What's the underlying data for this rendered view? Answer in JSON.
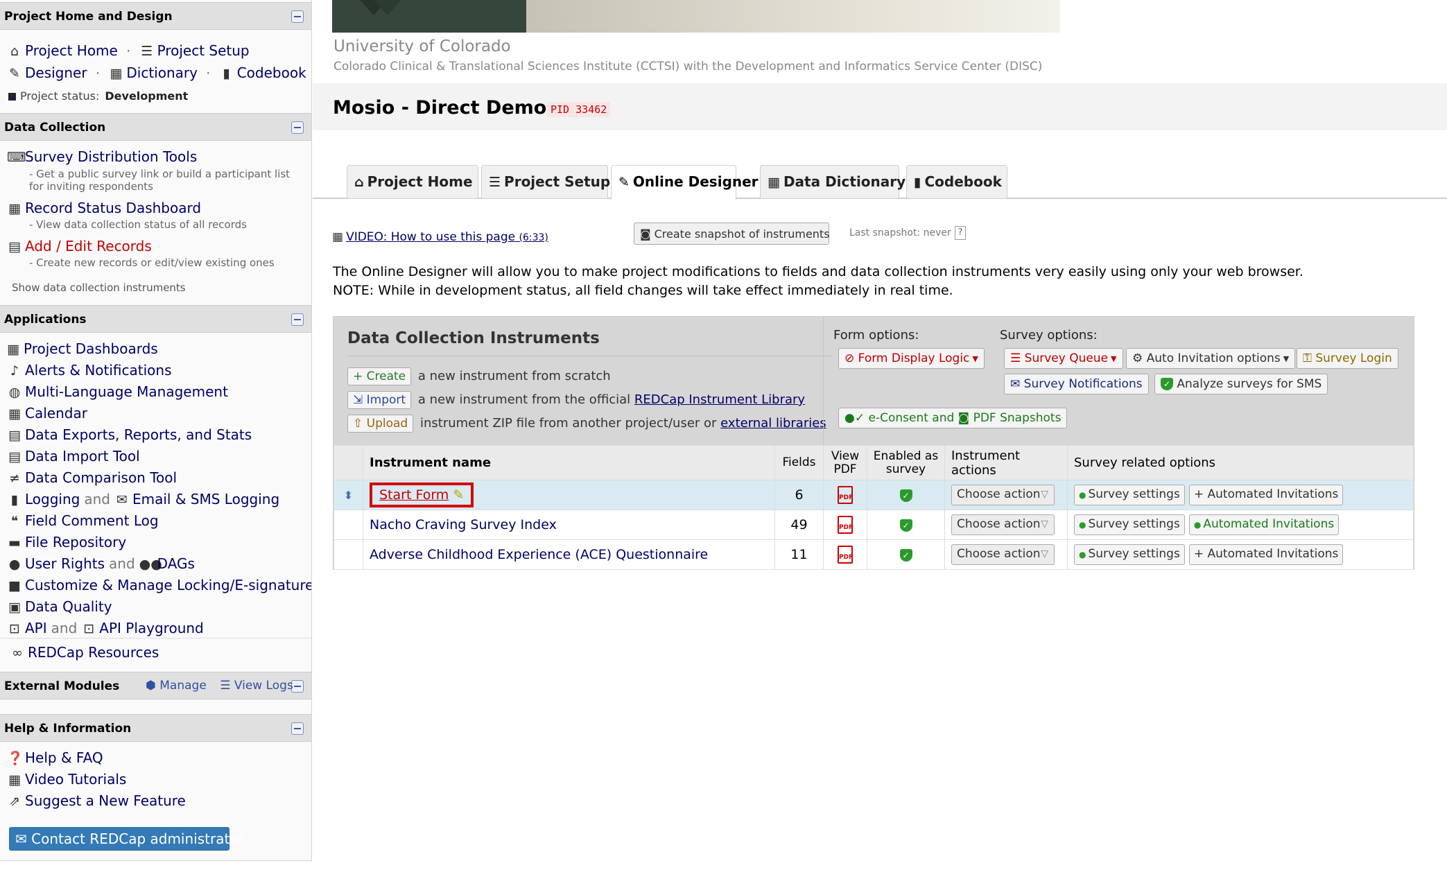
{
  "sidebar": {
    "project_home_design": {
      "title": "Project Home and Design",
      "project_home": "Project Home",
      "project_setup": "Project Setup",
      "designer": "Designer",
      "dictionary": "Dictionary",
      "codebook": "Codebook",
      "status_label": "Project status:",
      "status_value": "Development"
    },
    "data_collection": {
      "title": "Data Collection",
      "survey_tools": "Survey Distribution Tools",
      "survey_tools_desc": "- Get a public survey link or build a participant list for inviting respondents",
      "record_status": "Record Status Dashboard",
      "record_status_desc": "- View data collection status of all records",
      "add_edit": "Add / Edit Records",
      "add_edit_desc": "- Create new records or edit/view existing ones",
      "show_instruments": "Show data collection instruments"
    },
    "applications": {
      "title": "Applications",
      "items": [
        "Project Dashboards",
        "Alerts & Notifications",
        "Multi-Language Management",
        "Calendar",
        "Data Exports, Reports, and Stats",
        "Data Import Tool",
        "Data Comparison Tool"
      ],
      "logging": "Logging",
      "email_sms_logging": "Email & SMS Logging",
      "and": "and",
      "field_comment_log": "Field Comment Log",
      "file_repository": "File Repository",
      "user_rights": "User Rights",
      "dags": "DAGs",
      "locking": "Customize & Manage Locking/E-signatures",
      "data_quality": "Data Quality",
      "api": "API",
      "api_playground": "API Playground",
      "redcap_resources": "REDCap Resources"
    },
    "external_modules": {
      "title": "External Modules",
      "manage": "Manage",
      "view_logs": "View Logs"
    },
    "help": {
      "title": "Help & Information",
      "faq": "Help & FAQ",
      "tutorials": "Video Tutorials",
      "suggest": "Suggest a New Feature",
      "contact": "Contact REDCap administrator"
    }
  },
  "header": {
    "institution": "University of Colorado",
    "institution_sub": "Colorado Clinical & Translational Sciences Institute (CCTSI) with the Development and Informatics Service Center (DISC)",
    "project_title": "Mosio - Direct Demo",
    "pid": "PID 33462"
  },
  "tabs": [
    {
      "label": "Project Home",
      "icon": "home-icon"
    },
    {
      "label": "Project Setup",
      "icon": "checklist-icon"
    },
    {
      "label": "Online Designer",
      "icon": "edit-icon"
    },
    {
      "label": "Data Dictionary",
      "icon": "excel-icon"
    },
    {
      "label": "Codebook",
      "icon": "book-icon"
    }
  ],
  "toolbar": {
    "video_link": "VIDEO: How to use this page",
    "video_duration": "(6:33)",
    "snapshot_button": "Create snapshot of instruments",
    "last_snapshot": "Last snapshot: never",
    "help_mark": "?"
  },
  "intro": {
    "line1": "The Online Designer will allow you to make project modifications to fields and data collection instruments very easily using only your web browser.",
    "line2": "NOTE: While in development status, all field changes will take effect immediately in real time."
  },
  "instruments_panel": {
    "title": "Data Collection Instruments",
    "create_btn": "Create",
    "create_text": "a new instrument from scratch",
    "import_btn": "Import",
    "import_text": "a new instrument from the official",
    "import_link": "REDCap Instrument Library",
    "upload_btn": "Upload",
    "upload_text": "instrument ZIP file from another project/user or",
    "upload_link": "external libraries",
    "form_options_label": "Form options:",
    "form_display_logic": "Form Display Logic",
    "survey_options_label": "Survey options:",
    "survey_queue": "Survey Queue",
    "auto_invitation": "Auto Invitation options",
    "survey_login": "Survey Login",
    "survey_notifications": "Survey Notifications",
    "analyze_sms": "Analyze surveys for SMS",
    "econsent": "e-Consent and",
    "pdf_snapshots": "PDF Snapshots"
  },
  "table": {
    "headers": {
      "name": "Instrument name",
      "fields": "Fields",
      "view_pdf_1": "View",
      "view_pdf_2": "PDF",
      "enabled_1": "Enabled as",
      "enabled_2": "survey",
      "actions": "Instrument actions",
      "survey_options": "Survey related options"
    },
    "rows": [
      {
        "name": "Start Form",
        "fields": "6",
        "action": "Choose action",
        "settings": "Survey settings",
        "invitations": "+ Automated Invitations",
        "invitations_active": false
      },
      {
        "name": "Nacho Craving Survey Index",
        "fields": "49",
        "action": "Choose action",
        "settings": "Survey settings",
        "invitations": "Automated Invitations",
        "invitations_active": true
      },
      {
        "name": "Adverse Childhood Experience (ACE) Questionnaire",
        "fields": "11",
        "action": "Choose action",
        "settings": "Survey settings",
        "invitations": "+ Automated Invitations",
        "invitations_active": false
      }
    ],
    "pdf_icon_text": "PDF"
  }
}
